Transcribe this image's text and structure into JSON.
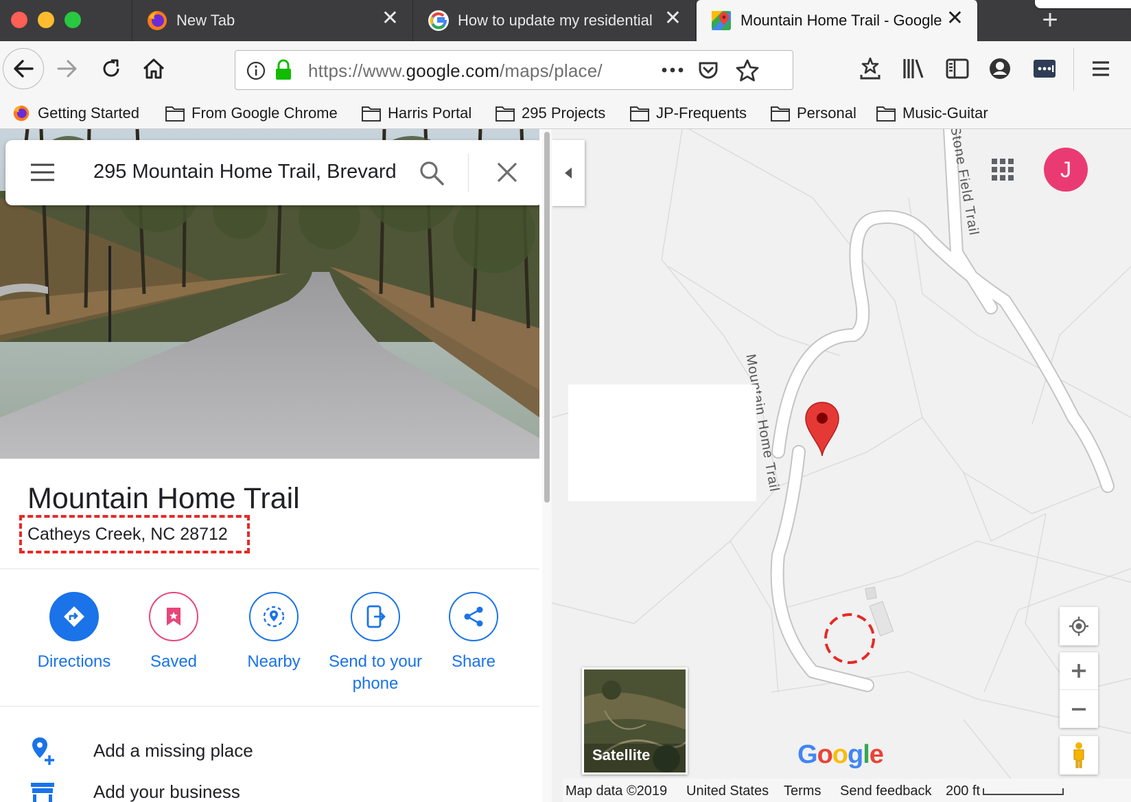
{
  "browser": {
    "tabs": [
      {
        "title": "New Tab"
      },
      {
        "title": "How to update my residential"
      },
      {
        "title": "Mountain Home Trail - Google"
      }
    ],
    "url_prefix": "https://www.",
    "url_domain": "google.com",
    "url_path": "/maps/place/",
    "bookmarks": [
      {
        "label": "Getting Started"
      },
      {
        "label": "From Google Chrome"
      },
      {
        "label": "Harris Portal"
      },
      {
        "label": "295 Projects"
      },
      {
        "label": "JP-Frequents"
      },
      {
        "label": "Personal"
      },
      {
        "label": "Music-Guitar"
      }
    ]
  },
  "maps": {
    "search": {
      "value": "295 Mountain Home Trail, Brevard"
    },
    "place": {
      "title": "Mountain Home Trail",
      "address": "Catheys Creek, NC 28712"
    },
    "actions": [
      {
        "label": "Directions"
      },
      {
        "label": "Saved"
      },
      {
        "label": "Nearby"
      },
      {
        "label": "Send to your phone"
      },
      {
        "label": "Share"
      }
    ],
    "list": [
      {
        "label": "Add a missing place"
      },
      {
        "label": "Add your business"
      }
    ],
    "account_initial": "J",
    "satellite_label": "Satellite",
    "logo": "Google",
    "road_labels": {
      "main": "Mountain Home Trail",
      "side": "Stone Field Trail"
    },
    "footer": {
      "map_data": "Map data ©2019",
      "region": "United States",
      "terms": "Terms",
      "feedback": "Send feedback",
      "scale": "200 ft"
    }
  },
  "colors": {
    "accent": "#1a73e8",
    "pin": "#e53935",
    "avatar": "#ea3a74",
    "highlight": "#e52a26"
  }
}
